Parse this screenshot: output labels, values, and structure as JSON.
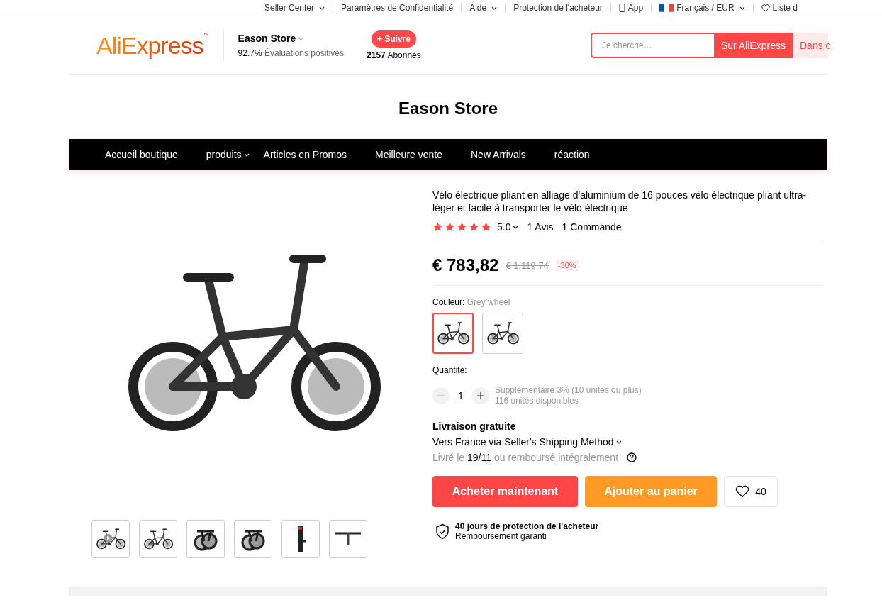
{
  "top_bar": {
    "items": [
      {
        "label": "Seller Center",
        "kind": "text",
        "dropdown": true
      },
      {
        "label": "Paramètres de Confidentialité",
        "kind": "text",
        "dropdown": false
      },
      {
        "label": "Aide",
        "kind": "text",
        "dropdown": true
      },
      {
        "label": "Protection de l'acheteur",
        "kind": "text",
        "dropdown": false
      },
      {
        "label": "App",
        "kind": "app",
        "dropdown": false
      },
      {
        "label": "Français / EUR",
        "kind": "language",
        "dropdown": true
      },
      {
        "label": "Liste d",
        "kind": "wishlist",
        "dropdown": false
      }
    ]
  },
  "header": {
    "logo": "AliExpress",
    "logo_mark": "™",
    "store": {
      "name": "Eason Store",
      "rating": "92.7%",
      "rating_label": "Évaluations positives",
      "follow_button": "+ Suivre",
      "followers": "2157",
      "followers_label": "Abonnés"
    },
    "search": {
      "placeholder": "Je cherche…",
      "buttons": [
        {
          "label": "Sur AliExpress",
          "selected": true
        },
        {
          "label": "Dans c",
          "selected": false
        }
      ]
    }
  },
  "store_title": "Eason Store",
  "nav": {
    "items": [
      {
        "label": "Accueil boutique",
        "dropdown": false
      },
      {
        "label": "produits",
        "dropdown": true
      },
      {
        "label": "Articles en Promos",
        "dropdown": false
      },
      {
        "label": "Meilleure vente",
        "dropdown": false
      },
      {
        "label": "New Arrivals",
        "dropdown": false
      },
      {
        "label": "réaction",
        "dropdown": false
      }
    ]
  },
  "gallery": {
    "thumbnails": [
      {
        "kind": "video"
      },
      {
        "kind": "side"
      },
      {
        "kind": "folded"
      },
      {
        "kind": "folded"
      },
      {
        "kind": "front"
      },
      {
        "kind": "handlebar"
      }
    ]
  },
  "product": {
    "title": "Vélo électrique pliant en alliage d'aluminium de 16 pouces vélo électrique pliant ultra-léger et facile à transporter le vélo électrique",
    "stars": 5,
    "rating": "5.0",
    "reviews": "1 Avis",
    "orders": "1 Commande",
    "price": "€ 783,82",
    "original_price": "€ 1.119,74",
    "discount": "-30%",
    "color_label": "Couleur:",
    "color_value": "Grey wheel",
    "color_options": [
      {
        "selected": true
      },
      {
        "selected": false
      }
    ],
    "quantity_label": "Quantité:",
    "quantity": "1",
    "decrease_disabled": true,
    "bulk_note": "Supplémentaire 3% (10 unités ou plus)",
    "stock": "116 unités disponibles",
    "shipping_title": "Livraison gratuite",
    "shipping_method": "Vers France via Seller's Shipping Method",
    "delivery_prefix": "Livré le",
    "delivery_date": "19/11",
    "delivery_suffix": "ou remboursé intégralement",
    "buy_button": "Acheter maintenant",
    "cart_button": "Ajouter au panier",
    "wishlist_count": "40",
    "protection_title": "40 jours de protection de l'acheteur",
    "protection_subtitle": "Remboursement garanti"
  }
}
